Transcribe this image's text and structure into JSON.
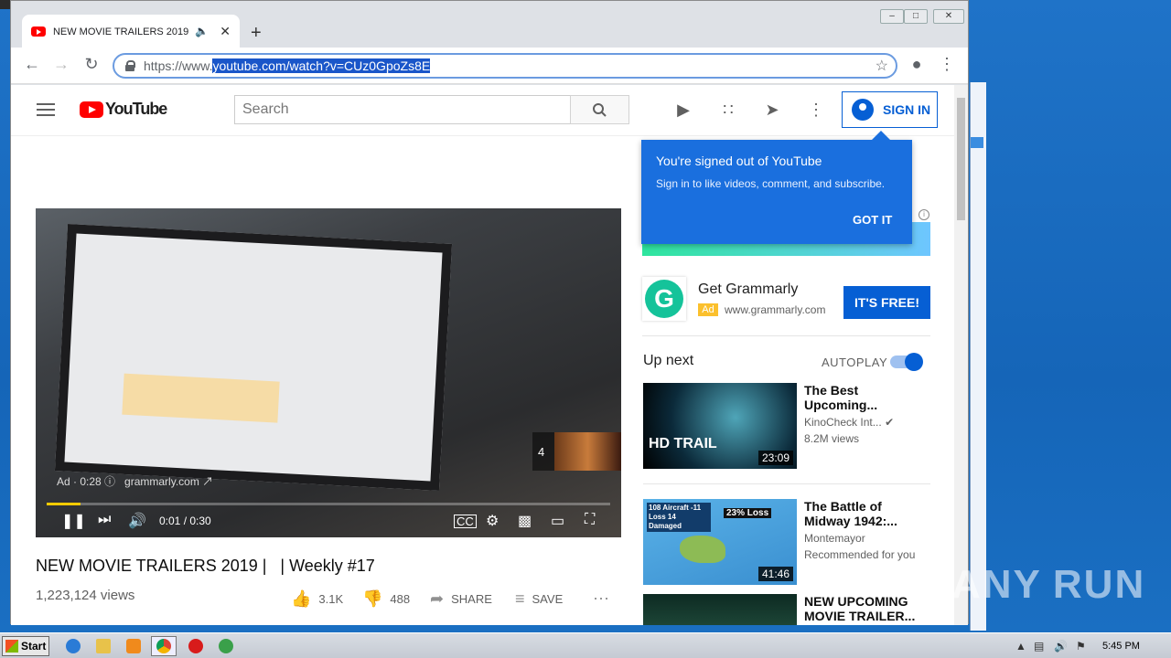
{
  "browser": {
    "tab_title": "NEW MOVIE TRAILERS 2019 ☐",
    "url_prefix": "https://www.",
    "url_selected": "youtube.com/watch?v=CUz0GpoZs8E"
  },
  "youtube": {
    "logo_text": "YouTube",
    "search_placeholder": "Search",
    "sign_in": "SIGN IN",
    "tooltip": {
      "title": "You're signed out of YouTube",
      "body": "Sign in to like videos, comment, and subscribe.",
      "button": "GOT IT"
    },
    "ad": {
      "title": "Get Grammarly",
      "badge": "Ad",
      "url": "www.grammarly.com",
      "cta": "IT'S FREE!"
    },
    "upnext": {
      "label": "Up next",
      "autoplay": "AUTOPLAY",
      "videos": [
        {
          "title": "The Best Upcoming...",
          "channel": "KinoCheck Int...",
          "meta": "8.2M views",
          "duration": "23:09",
          "thumb_text": "HD TRAIL"
        },
        {
          "title": "The Battle of Midway 1942:...",
          "channel": "Montemayor",
          "meta": "Recommended for you",
          "duration": "41:46",
          "thumb_text": "108 Aircraft -11 Loss 14 Damaged",
          "thumb_badge": "23% Loss"
        },
        {
          "title": "NEW UPCOMING MOVIE TRAILER..."
        }
      ]
    },
    "player": {
      "ad_text": "Ad · 0:28",
      "ad_domain": "grammarly.com",
      "time": "0:01 / 0:30",
      "endcard_num": "4",
      "progress": 0.06
    },
    "video": {
      "title": "NEW MOVIE TRAILERS 2019 |   | Weekly #17",
      "views": "1,223,124 views",
      "likes": "3.1K",
      "dislikes": "488",
      "share": "SHARE",
      "save": "SAVE"
    }
  },
  "taskbar": {
    "start": "Start",
    "clock": "5:45 PM"
  },
  "watermark": {
    "left": "ANY",
    "right": "RUN"
  }
}
